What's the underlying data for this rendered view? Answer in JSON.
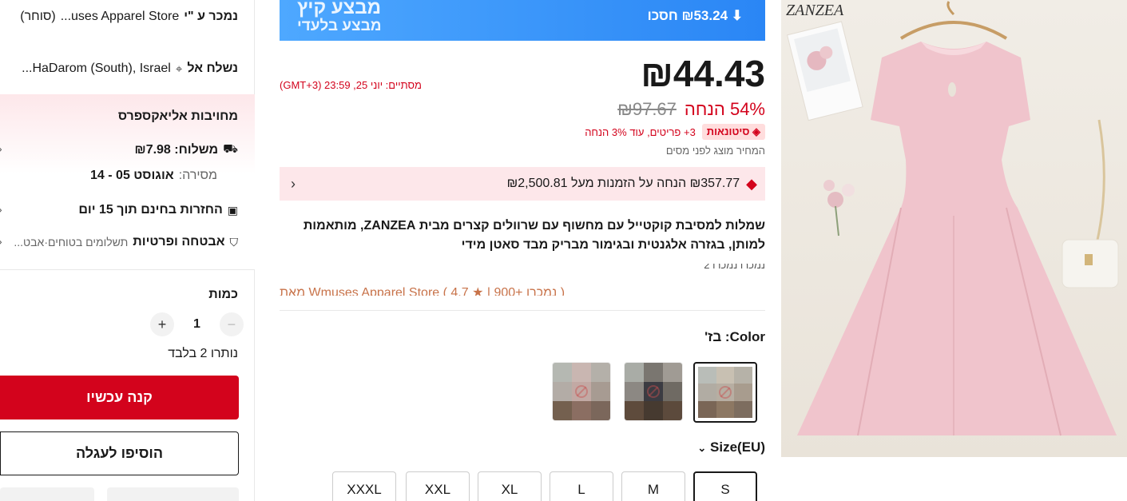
{
  "left": {
    "sold_by_label": "נמכר ע \"י",
    "sold_by_store": "...uses Apparel Store",
    "sold_by_seller": "(סוחר)",
    "ship_to_label": "נשלח אל",
    "ship_to_value": "...HaDarom (South), Israel",
    "promise_title": "מחויבות אליאקספרס",
    "shipping_label": "משלוח: ₪7.98",
    "delivery_prefix": "מסירה:",
    "delivery_value": "אוגוסט 05 - 14",
    "returns_text": "החזרות בחינם תוך 15 יום",
    "security_text": "אבטחה ופרטיות",
    "security_sub": "תשלומים בטוחים·אבט...",
    "quantity_label": "כמות",
    "quantity_value": "1",
    "stock_text": "נותרו 2 בלבד",
    "buy_now": "קנה עכשיו",
    "add_to_cart": "הוסיפו לעגלה"
  },
  "banner": {
    "title": "מבצע קיץ",
    "subtitle": "מבצע בלעדי",
    "save_text": "₪53.24 חסכו"
  },
  "price": {
    "current": "₪44.43",
    "countdown": "מסתיים: יוני 25, 23:59 (GMT+3)",
    "discount": "54% הנחה",
    "original": "₪97.67",
    "bulk_tag": "סיטונאות",
    "bulk_text": "3+ פריטים, עוד 3% הנחה",
    "tax_note": "המחיר מוצג לפני מסים"
  },
  "coupon": {
    "text": "₪357.77 הנחה על הזמנות מעל ₪2,500.81"
  },
  "product": {
    "title": "שמלות למסיבת קוקטייל עם מחשוף עם שרוולים קצרים מבית ZANZEA, מותאמות למותן, בגזרה אלגנטית ובגימור מבריק מבד סאטן מידי",
    "sold_count_line": "נמכרו נמכרו 2",
    "store_line": "מאת Wmuses Apparel Store ( 4.7 ★ | 900+ נמכרו )"
  },
  "color": {
    "label": "Color: בז'"
  },
  "size": {
    "label": "Size(EU)",
    "options": [
      "S",
      "M",
      "L",
      "XL",
      "XXL",
      "XXXL"
    ]
  },
  "image": {
    "brand": "ZANZEA"
  },
  "colors": {
    "accent": "#d3031c",
    "banner": "#3d9bff",
    "coupon_bg": "#fde7ea"
  }
}
